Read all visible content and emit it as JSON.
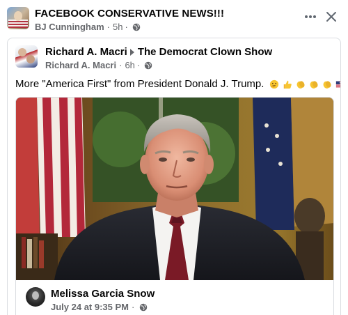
{
  "outer_post": {
    "title": "FACEBOOK CONSERVATIVE NEWS!!!",
    "author": "BJ Cunningham",
    "time": "5h",
    "separator": "·",
    "privacy_icon": "globe-icon",
    "more_icon": "more-horizontal-icon",
    "close_icon": "close-icon"
  },
  "shared_post": {
    "author": "Richard A. Macri",
    "target_group": "The Democrat Clown Show",
    "meta_author": "Richard A. Macri",
    "time": "6h",
    "separator": "·",
    "text": "More \"America First\" from President Donald J. Trump.",
    "emojis": [
      "thinking-face",
      "thumbs-up",
      "clapping-hands",
      "clapping-hands",
      "clapping-hands",
      "us-flag"
    ]
  },
  "inner_post": {
    "author": "Melissa Garcia Snow",
    "date": "July 24 at 9:35 PM",
    "separator": "·",
    "photo_icon": "photo-of-man-in-suit-at-desk"
  },
  "colors": {
    "text_primary": "#050505",
    "text_secondary": "#65676b",
    "border": "#dadde1",
    "background": "#ffffff"
  }
}
